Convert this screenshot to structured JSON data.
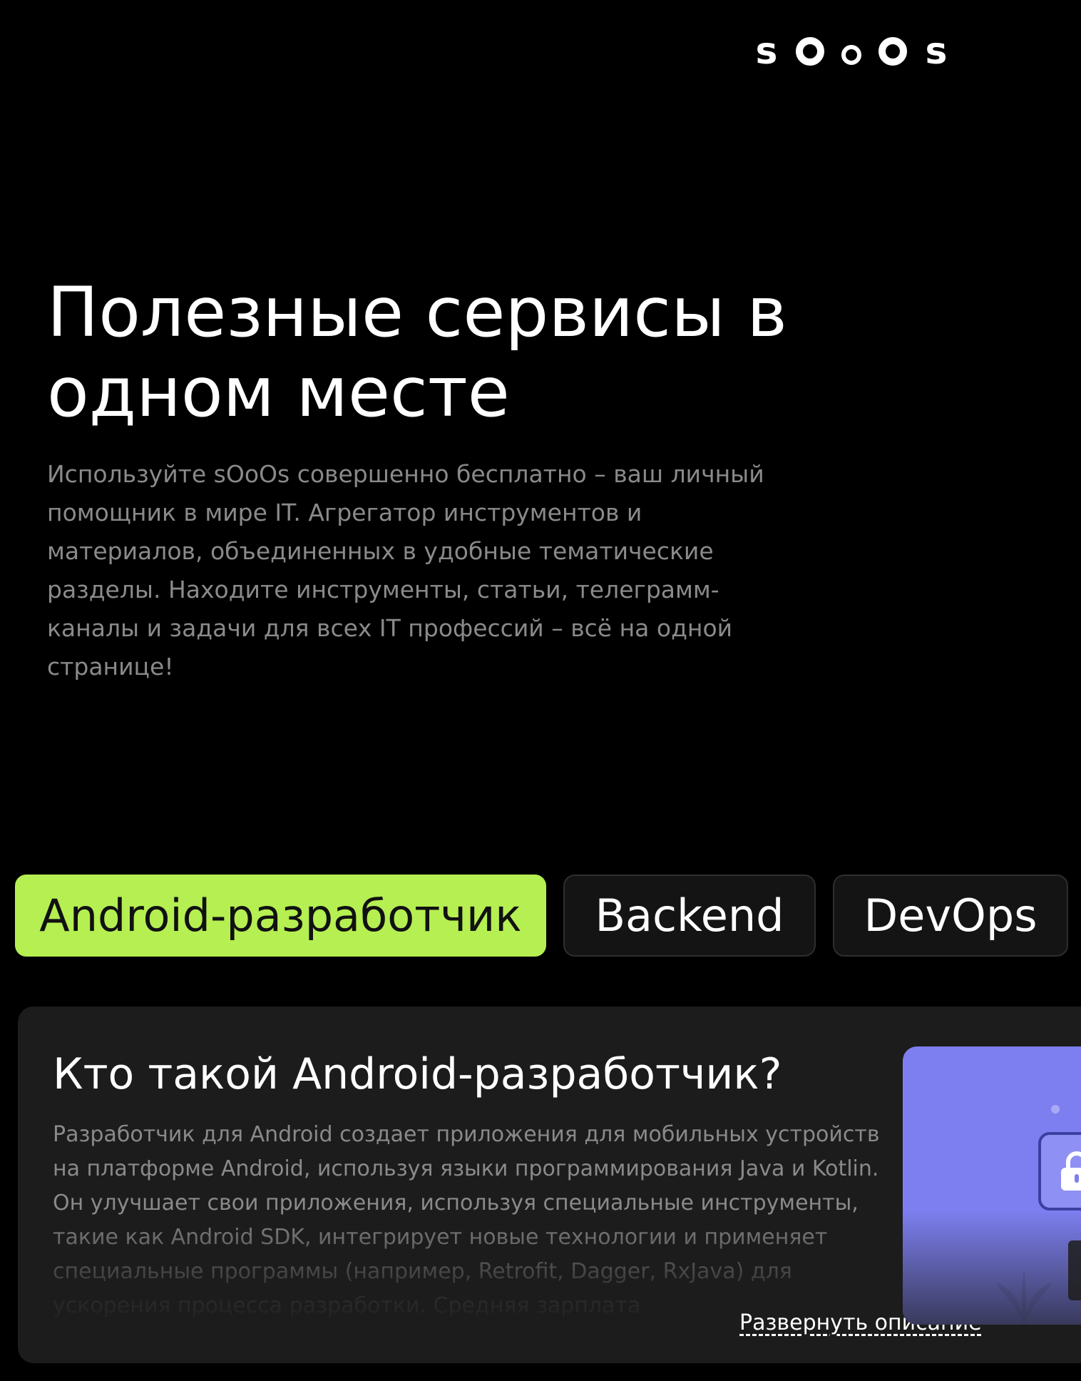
{
  "header": {
    "logo_text": "sOoOs",
    "logo_letters": [
      "s",
      "s"
    ]
  },
  "hero": {
    "title": "Полезные сервисы в одном месте",
    "description": "Используйте sOoOs совершенно бесплатно – ваш личный помощник в мире IT. Агрегатор инструментов и материалов, объединенных в удобные тематические разделы. Находите инструменты, статьи, телеграмм-каналы и задачи для всех IT профессий – всё на одной странице!"
  },
  "tabs": [
    {
      "label": "Android-разработчик",
      "active": true
    },
    {
      "label": "Backend",
      "active": false
    },
    {
      "label": "DevOps",
      "active": false
    }
  ],
  "card": {
    "title": "Кто такой Android-разработчик?",
    "description": "Разработчик для Android создает приложения для мобильных устройств на платформе Android, используя языки программирования Java и Kotlin. Он улучшает свои приложения, используя специальные инструменты, такие как Android SDK, интегрирует новые технологии и применяет специальные программы (например, Retrofit, Dagger, RxJava) для ускорения процесса разработки. Средняя зарплата",
    "expand_label": "Развернуть описание",
    "illustration_icon": "lock-icon"
  },
  "colors": {
    "background": "#000000",
    "accent": "#b5ef52",
    "card_bg": "#1c1c1c",
    "muted_text": "#8a8a8a",
    "illustration_bg": "#7d7ff0"
  }
}
